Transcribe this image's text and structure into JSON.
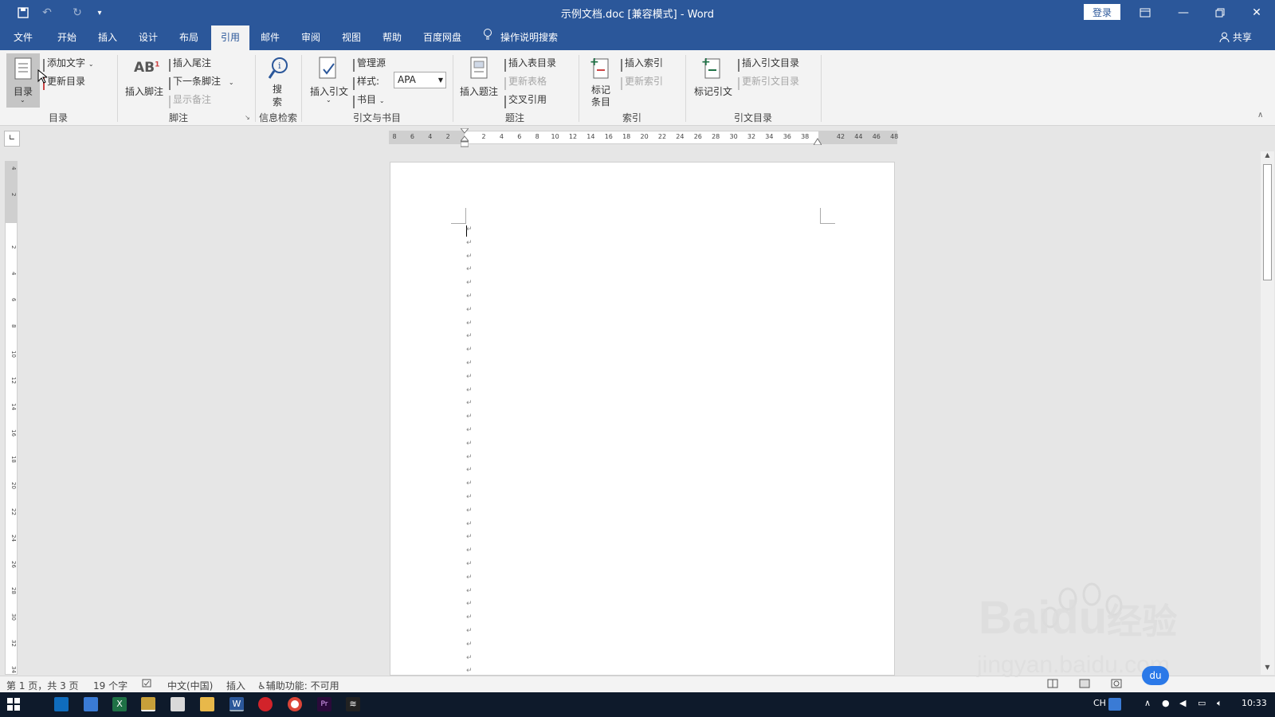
{
  "titlebar": {
    "title": "示例文档.doc [兼容模式]  -  Word",
    "login": "登录"
  },
  "tabs": [
    {
      "label": "文件"
    },
    {
      "label": "开始"
    },
    {
      "label": "插入"
    },
    {
      "label": "设计"
    },
    {
      "label": "布局"
    },
    {
      "label": "引用"
    },
    {
      "label": "邮件"
    },
    {
      "label": "审阅"
    },
    {
      "label": "视图"
    },
    {
      "label": "帮助"
    },
    {
      "label": "百度网盘"
    }
  ],
  "active_tab": "引用",
  "tell_me": "操作说明搜索",
  "share": "共享",
  "ribbon": {
    "toc": {
      "big_label": "目录",
      "add_text": "添加文字",
      "update_toc": "更新目录",
      "group_label": "目录"
    },
    "footnotes": {
      "insert_footnote": "插入脚注",
      "insert_endnote": "插入尾注",
      "next_footnote": "下一条脚注",
      "show_notes": "显示备注",
      "group_label": "脚注"
    },
    "research": {
      "search_line1": "搜",
      "search_line2": "索",
      "group_label": "信息检索"
    },
    "citations": {
      "insert_citation": "插入引文",
      "manage_sources": "管理源",
      "style_label": "样式:",
      "style_value": "APA",
      "bibliography": "书目",
      "group_label": "引文与书目"
    },
    "captions": {
      "insert_caption": "插入题注",
      "insert_table_of_figures": "插入表目录",
      "update_table": "更新表格",
      "cross_reference": "交叉引用",
      "group_label": "题注"
    },
    "index": {
      "mark_entry_line1": "标记",
      "mark_entry_line2": "条目",
      "insert_index": "插入索引",
      "update_index": "更新索引",
      "group_label": "索引"
    },
    "toa": {
      "mark_citation": "标记引文",
      "insert_toa": "插入引文目录",
      "update_toa": "更新引文目录",
      "group_label": "引文目录"
    }
  },
  "ruler": {
    "ticks": [
      "8",
      "6",
      "4",
      "2",
      "",
      "2",
      "4",
      "6",
      "8",
      "10",
      "12",
      "14",
      "16",
      "18",
      "20",
      "22",
      "24",
      "26",
      "28",
      "30",
      "32",
      "34",
      "36",
      "38",
      "",
      "42",
      "44",
      "46",
      "48"
    ]
  },
  "vruler": {
    "ticks": [
      "4",
      "2",
      "",
      "2",
      "4",
      "6",
      "8",
      "10",
      "12",
      "14",
      "16",
      "18",
      "20",
      "22",
      "24",
      "26",
      "28",
      "30",
      "32",
      "34"
    ]
  },
  "document": {
    "paragraph_mark": "↵",
    "paragraph_count": 34
  },
  "status": {
    "page": "第 1 页，共 3 页",
    "words": "19 个字",
    "language": "中文(中国)",
    "mode": "插入",
    "accessibility": "辅助功能: 不可用"
  },
  "taskbar": {
    "lang": "CH",
    "time": "10:33",
    "colors": {
      "outlook": "#0f6cbd",
      "excel": "#1e7145",
      "word": "#2b579a",
      "premiere": "#2a0a3a"
    }
  },
  "watermark": {
    "brand": "Baidu",
    "suffix": "经验",
    "url": "jingyan.baidu.com"
  },
  "colors": {
    "accent": "#2b579a",
    "ribbon": "#f3f3f3",
    "canvas": "#e6e6e6"
  }
}
